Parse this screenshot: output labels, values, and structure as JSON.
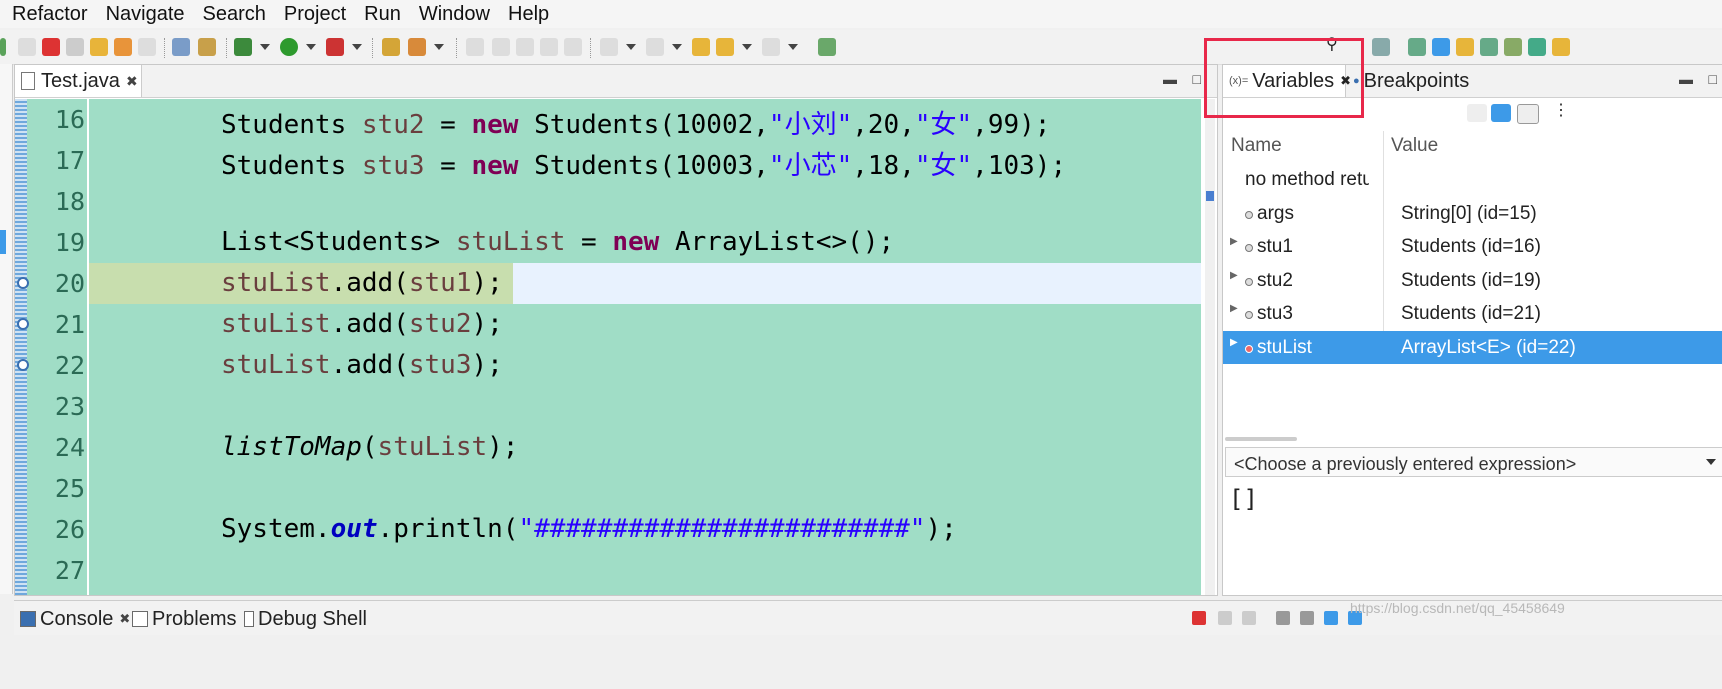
{
  "menu": [
    "Refactor",
    "Navigate",
    "Search",
    "Project",
    "Run",
    "Window",
    "Help"
  ],
  "editor": {
    "tab_label": "Test.java",
    "lines": [
      {
        "num": "16",
        "stmt": "Students stu2 = new Students(10002,\"小刘\",20,\"女\",99);"
      },
      {
        "num": "17",
        "stmt": "Students stu3 = new Students(10003,\"小芯\",18,\"女\",103);"
      },
      {
        "num": "18",
        "stmt": ""
      },
      {
        "num": "19",
        "stmt": "List<Students> stuList = new ArrayList<>();"
      },
      {
        "num": "20",
        "stmt": "stuList.add(stu1);"
      },
      {
        "num": "21",
        "stmt": "stuList.add(stu2);"
      },
      {
        "num": "22",
        "stmt": "stuList.add(stu3);"
      },
      {
        "num": "23",
        "stmt": ""
      },
      {
        "num": "24",
        "stmt": "listToMap(stuList);"
      },
      {
        "num": "25",
        "stmt": ""
      },
      {
        "num": "26",
        "stmt": "System.out.println(\"########################\");"
      },
      {
        "num": "27",
        "stmt": ""
      }
    ],
    "tokens": {
      "students": "Students",
      "stu1": "stu1",
      "stu2": "stu2",
      "stu3": "stu3",
      "new": "new",
      "stu2_args_a": "(10002,",
      "stu2_s1": "\"小刘\"",
      "stu2_args_b": ",20,",
      "stu2_s2": "\"女\"",
      "stu2_args_c": ",99);",
      "stu3_args_a": "(10003,",
      "stu3_s1": "\"小芯\"",
      "stu3_args_b": ",18,",
      "stu3_s2": "\"女\"",
      "stu3_args_c": ",103);",
      "list_type": "List<Students>",
      "stuList": "stuList",
      "arraylist": "ArrayList<>();",
      "add": ".add(",
      "close": ");",
      "listToMap": "listToMap",
      "open": "(",
      "system": "System.",
      "out": "out",
      "println": ".println(",
      "hashes": "\"########################\""
    }
  },
  "variables": {
    "tab_label": "Variables",
    "breakpoints_label": "Breakpoints",
    "col_name": "Name",
    "col_value": "Value",
    "rows": [
      {
        "name": "no method return",
        "value": ""
      },
      {
        "name": "args",
        "value": "String[0]  (id=15)"
      },
      {
        "name": "stu1",
        "value": "Students  (id=16)"
      },
      {
        "name": "stu2",
        "value": "Students  (id=19)"
      },
      {
        "name": "stu3",
        "value": "Students  (id=21)"
      },
      {
        "name": "stuList",
        "value": "ArrayList<E>  (id=22)"
      }
    ],
    "expression_placeholder": "<Choose a previously entered expression>",
    "detail_value": "[]"
  },
  "bottom": {
    "console_label": "Console",
    "problems_label": "Problems",
    "debug_shell_label": "Debug Shell",
    "watermark": "https://blog.csdn.net/qq_45458649"
  },
  "colors": {
    "editor_bg": "#a0ddc6",
    "keyword": "#7f0055",
    "string": "#2a00ff",
    "selection": "#3d9ae8",
    "highlight_box": "#e8284a"
  }
}
